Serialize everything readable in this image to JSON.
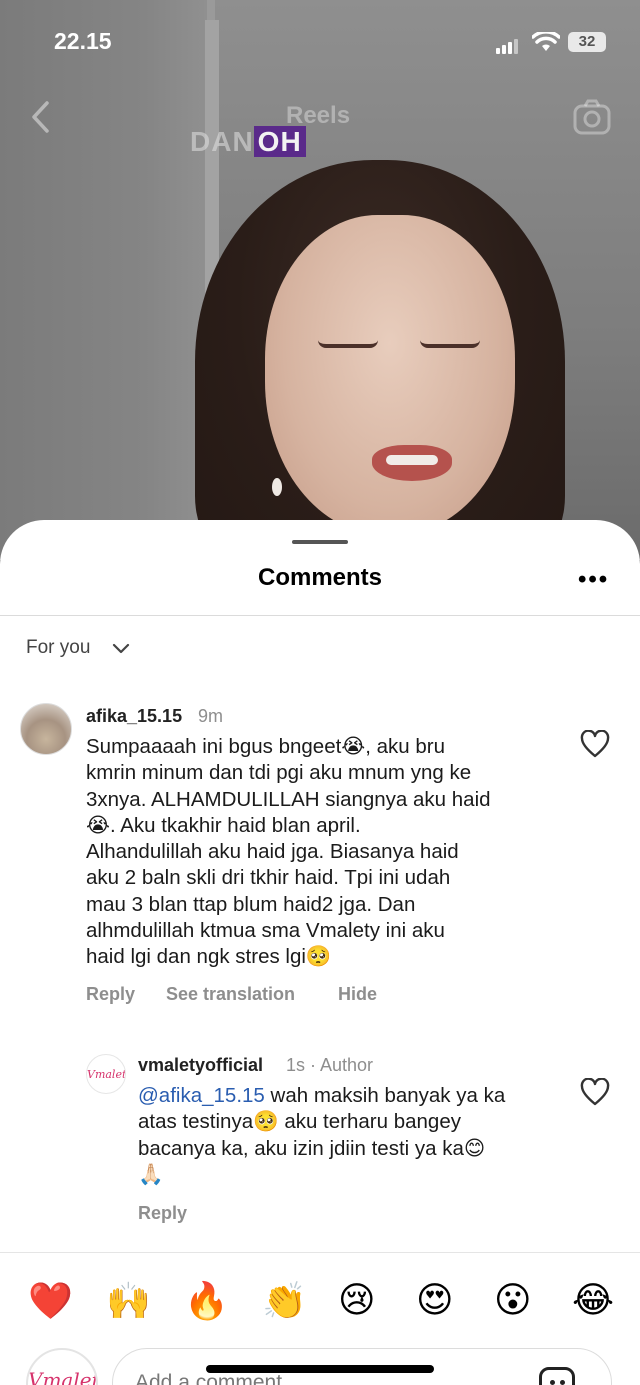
{
  "status_bar": {
    "time": "22.15",
    "battery": "32"
  },
  "video": {
    "header_title": "Reels",
    "overlay_text_1": "DAN",
    "overlay_text_2": "OH"
  },
  "sheet": {
    "title": "Comments",
    "filter_label": "For you",
    "comments": [
      {
        "username": "afika_15.15",
        "time": "9m",
        "lines": [
          "Sumpaaaah ini bgus bngeet😭, aku bru",
          "kmrin minum dan tdi pgi aku mnum yng ke",
          "3xnya. ALHAMDULILLAH siangnya aku haid",
          "😭. Aku tkakhir haid blan april.",
          "Alhandulillah aku haid jga.  Biasanya haid",
          "aku 2 baln skli dri tkhir haid. Tpi ini udah",
          "mau 3 blan ttap blum haid2 jga. Dan",
          "alhmdulillah ktmua sma Vmalety ini aku",
          "haid lgi dan ngk stres lgi🥺"
        ],
        "actions": [
          "Reply",
          "See translation",
          "Hide"
        ]
      }
    ],
    "reply": {
      "username": "vmaletyofficial",
      "meta": "1s · Author",
      "mention": "@afika_15.15",
      "line1_rest": " wah maksih banyak ya ka",
      "lines": [
        "atas testinya🥺  aku terharu bangey",
        "bacanya ka, aku izin jdiin testi ya ka😊",
        "🙏🏻"
      ],
      "action": "Reply",
      "avatar_text": "Vmalety"
    },
    "reactions": [
      "❤️",
      "🙌",
      "🔥",
      "👏",
      "😢",
      "😍",
      "😮",
      "😂"
    ],
    "input": {
      "placeholder": "Add a comment...",
      "avatar_text": "Vmalety"
    }
  }
}
